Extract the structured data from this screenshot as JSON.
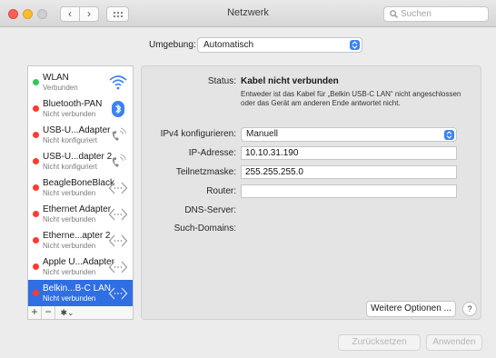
{
  "window": {
    "title": "Netzwerk"
  },
  "search": {
    "placeholder": "Suchen"
  },
  "location": {
    "label": "Umgebung:",
    "value": "Automatisch"
  },
  "services": [
    {
      "name": "WLAN",
      "status": "Verbunden",
      "status_color": "#34c759",
      "icon": "wifi-icon"
    },
    {
      "name": "Bluetooth-PAN",
      "status": "Nicht verbunden",
      "status_color": "#ff3b30",
      "icon": "bluetooth-icon"
    },
    {
      "name": "USB-U...Adapter",
      "status": "Nicht konfiguriert",
      "status_color": "#ff3b30",
      "icon": "phone-icon"
    },
    {
      "name": "USB-U...dapter 2",
      "status": "Nicht konfiguriert",
      "status_color": "#ff3b30",
      "icon": "phone-icon"
    },
    {
      "name": "BeagleBoneBlack",
      "status": "Nicht verbunden",
      "status_color": "#ff3b30",
      "icon": "ethernet-icon"
    },
    {
      "name": "Ethernet Adapter",
      "status": "Nicht verbunden",
      "status_color": "#ff3b30",
      "icon": "ethernet-icon"
    },
    {
      "name": "Etherne...apter 2",
      "status": "Nicht verbunden",
      "status_color": "#ff3b30",
      "icon": "ethernet-icon"
    },
    {
      "name": "Apple U...Adapter",
      "status": "Nicht verbunden",
      "status_color": "#ff3b30",
      "icon": "ethernet-icon"
    },
    {
      "name": "Belkin...B-C LAN",
      "status": "Nicht verbunden",
      "status_color": "#ff3b30",
      "icon": "ethernet-icon",
      "selected": true
    }
  ],
  "sidebar_toolbar": {
    "add": "+",
    "remove": "−",
    "gear": "✱⌄"
  },
  "detail": {
    "status_label": "Status:",
    "status_value": "Kabel nicht verbunden",
    "status_description": "Entweder ist das Kabel für „Belkin USB-C LAN“ nicht angeschlossen oder das Gerät am anderen Ende antwortet nicht.",
    "ipv4_label": "IPv4 konfigurieren:",
    "ipv4_value": "Manuell",
    "ip_label": "IP-Adresse:",
    "ip_value": "10.10.31.190",
    "subnet_label": "Teilnetzmaske:",
    "subnet_value": "255.255.255.0",
    "router_label": "Router:",
    "router_value": "",
    "dns_label": "DNS-Server:",
    "search_domains_label": "Such-Domains:"
  },
  "buttons": {
    "more_options": "Weitere Optionen ...",
    "help": "?",
    "reset": "Zurücksetzen",
    "apply": "Anwenden"
  },
  "colors": {
    "accent": "#2f6ee3",
    "select_arrow": "#3b82f6"
  }
}
